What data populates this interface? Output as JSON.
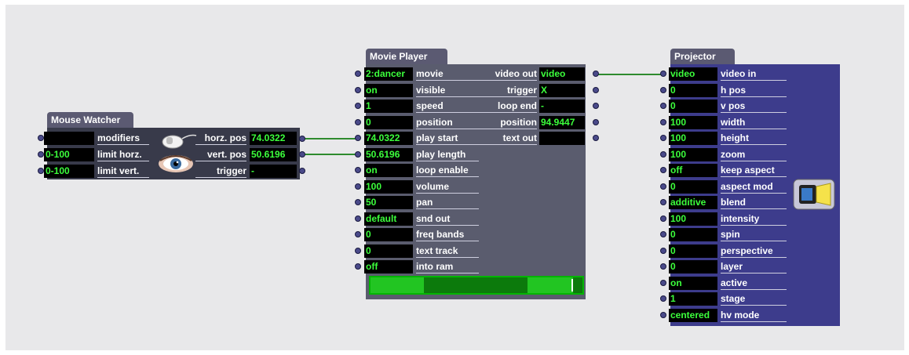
{
  "mouse_watcher": {
    "title": "Mouse Watcher",
    "inputs": [
      {
        "value": "",
        "label": "modifiers"
      },
      {
        "value": "0-100",
        "label": "limit horz."
      },
      {
        "value": "0-100",
        "label": "limit vert."
      }
    ],
    "outputs": [
      {
        "label": "horz. pos",
        "value": "74.0322"
      },
      {
        "label": "vert. pos",
        "value": "50.6196"
      },
      {
        "label": "trigger",
        "value": "-"
      }
    ]
  },
  "movie_player": {
    "title": "Movie Player",
    "inputs": [
      {
        "value": "2:dancer",
        "label": "movie"
      },
      {
        "value": "on",
        "label": "visible"
      },
      {
        "value": "1",
        "label": "speed"
      },
      {
        "value": "0",
        "label": "position"
      },
      {
        "value": "74.0322",
        "label": "play start"
      },
      {
        "value": "50.6196",
        "label": "play length"
      },
      {
        "value": "on",
        "label": "loop enable"
      },
      {
        "value": "100",
        "label": "volume"
      },
      {
        "value": "50",
        "label": "pan"
      },
      {
        "value": "default",
        "label": "snd out"
      },
      {
        "value": "0",
        "label": "freq bands"
      },
      {
        "value": "0",
        "label": "text track"
      },
      {
        "value": "off",
        "label": "into ram"
      }
    ],
    "outputs": [
      {
        "label": "video out",
        "value": "video"
      },
      {
        "label": "trigger",
        "value": "X"
      },
      {
        "label": "loop end",
        "value": "-"
      },
      {
        "label": "position",
        "value": "94.9447"
      },
      {
        "label": "text out",
        "value": ""
      }
    ]
  },
  "projector": {
    "title": "Projector",
    "inputs": [
      {
        "value": "video",
        "label": "video in"
      },
      {
        "value": "0",
        "label": "h pos"
      },
      {
        "value": "0",
        "label": "v pos"
      },
      {
        "value": "100",
        "label": "width"
      },
      {
        "value": "100",
        "label": "height"
      },
      {
        "value": "100",
        "label": "zoom"
      },
      {
        "value": "off",
        "label": "keep aspect"
      },
      {
        "value": "0",
        "label": "aspect mod"
      },
      {
        "value": "additive",
        "label": "blend"
      },
      {
        "value": "100",
        "label": "intensity"
      },
      {
        "value": "0",
        "label": "spin"
      },
      {
        "value": "0",
        "label": "perspective"
      },
      {
        "value": "0",
        "label": "layer"
      },
      {
        "value": "on",
        "label": "active"
      },
      {
        "value": "1",
        "label": "stage"
      },
      {
        "value": "centered",
        "label": "hv mode"
      }
    ]
  },
  "colors": {
    "wire": "#2e8b2e",
    "value_text": "#3cff3c",
    "projector_body": "#3d3c8c",
    "movie_body": "#5a5c6e"
  }
}
